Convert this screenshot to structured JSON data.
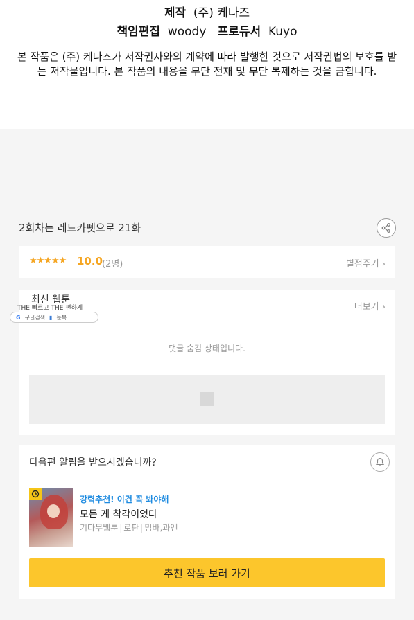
{
  "credits": {
    "line1_role": "제작",
    "line1_name": "(주) 케나즈",
    "line2_role1": "책임편집",
    "line2_name1": "woody",
    "line2_role2": "프로듀서",
    "line2_name2": "Kuyo",
    "copyright": "본 작품은 (주) 케나즈가 저작권자와의 계약에 따라 발행한 것으로 저작권법의 보호를 받는 저작물입니다. 본 작품의 내용을 무단 전재 및 무단 복제하는 것을 금합니다."
  },
  "episode": {
    "title": "2회차는 레드카펫으로 21화"
  },
  "rating": {
    "stars": "★★★★★",
    "score": "10.0",
    "count": "(2명)",
    "rate_label": "별점주기"
  },
  "latest": {
    "title": "최신 웹툰",
    "more_label": "더보기",
    "overlay_text": "THE 빠르고 THE 편하게",
    "badge_google": "구글검색",
    "badge_book": "툰북",
    "hidden_message": "댓글 숨김 상태입니다."
  },
  "notify": {
    "question": "다음편 알림을 받으시겠습니까?"
  },
  "recommend": {
    "tag": "강력추천! 이건 꼭 봐야해",
    "title": "모든 게 착각이었다",
    "meta": [
      "기다무웹툰",
      "로판",
      "밈바,과엔"
    ],
    "cta_label": "추천 작품 보러 가기"
  },
  "colors": {
    "accent_yellow": "#fcc62c",
    "star_orange": "#f5a623",
    "link_blue": "#1e8be0"
  },
  "icons": [
    "share-icon",
    "chevron-right-icon",
    "bell-icon",
    "clock-icon",
    "google-icon",
    "book-icon",
    "image-placeholder-icon"
  ]
}
